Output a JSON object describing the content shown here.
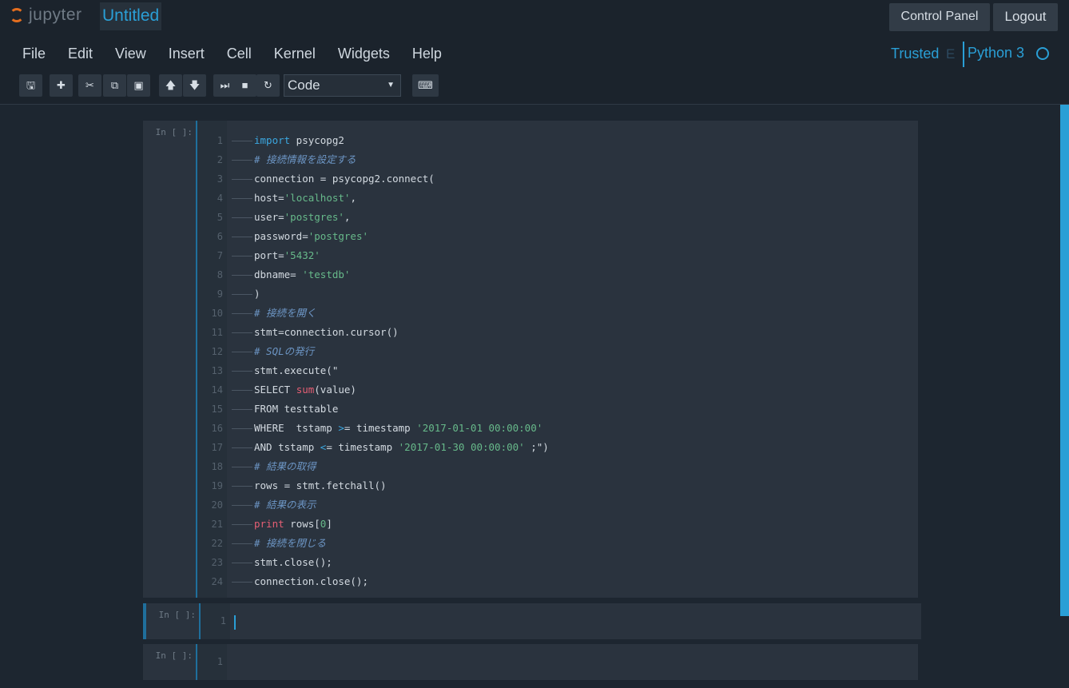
{
  "header": {
    "logo_text": "jupyter",
    "notebook_name": "Untitled",
    "control_panel_label": "Control Panel",
    "logout_label": "Logout"
  },
  "menu": [
    "File",
    "Edit",
    "View",
    "Insert",
    "Cell",
    "Kernel",
    "Widgets",
    "Help"
  ],
  "status": {
    "trusted": "Trusted",
    "mode_indicator": "E",
    "kernel": "Python 3"
  },
  "toolbar": {
    "buttons": [
      {
        "name": "save-button",
        "icon": "floppy-disk-icon",
        "glyph": "🖫"
      },
      {
        "name": "insert-cell-button",
        "icon": "plus-icon",
        "glyph": "✚"
      },
      {
        "name": "cut-button",
        "icon": "scissors-icon",
        "glyph": "✂"
      },
      {
        "name": "copy-button",
        "icon": "copy-icon",
        "glyph": "⧉"
      },
      {
        "name": "paste-button",
        "icon": "paste-icon",
        "glyph": "▣"
      },
      {
        "name": "move-up-button",
        "icon": "arrow-up-icon",
        "glyph": "🡅"
      },
      {
        "name": "move-down-button",
        "icon": "arrow-down-icon",
        "glyph": "🡇"
      },
      {
        "name": "run-button",
        "icon": "step-forward-icon",
        "glyph": "⏭"
      },
      {
        "name": "interrupt-button",
        "icon": "stop-icon",
        "glyph": "■"
      },
      {
        "name": "restart-button",
        "icon": "refresh-icon",
        "glyph": "↻"
      },
      {
        "name": "command-palette-button",
        "icon": "keyboard-icon",
        "glyph": "⌨"
      }
    ],
    "cell_type": "Code"
  },
  "cells": [
    {
      "prompt": "In [ ]:",
      "lines": [
        [
          {
            "t": "import",
            "c": "kw"
          },
          {
            "t": " psycopg2"
          }
        ],
        [
          {
            "t": "# 接続情報を設定する",
            "c": "cm"
          }
        ],
        [
          {
            "t": "connection = psycopg2.connect("
          }
        ],
        [
          {
            "t": "host="
          },
          {
            "t": "'localhost'",
            "c": "st"
          },
          {
            "t": ","
          }
        ],
        [
          {
            "t": "user="
          },
          {
            "t": "'postgres'",
            "c": "st"
          },
          {
            "t": ","
          }
        ],
        [
          {
            "t": "password="
          },
          {
            "t": "'postgres'",
            "c": "st"
          }
        ],
        [
          {
            "t": "port="
          },
          {
            "t": "'5432'",
            "c": "st"
          }
        ],
        [
          {
            "t": "dbname= "
          },
          {
            "t": "'testdb'",
            "c": "st"
          }
        ],
        [
          {
            "t": ")"
          }
        ],
        [
          {
            "t": "# 接続を開く",
            "c": "cm"
          }
        ],
        [
          {
            "t": "stmt=connection.cursor()"
          }
        ],
        [
          {
            "t": "# SQLの発行",
            "c": "cm"
          }
        ],
        [
          {
            "t": "stmt.execute(\""
          }
        ],
        [
          {
            "t": "SELECT "
          },
          {
            "t": "sum",
            "c": "fn"
          },
          {
            "t": "(value)"
          }
        ],
        [
          {
            "t": "FROM testtable"
          }
        ],
        [
          {
            "t": "WHERE  tstamp "
          },
          {
            "t": ">",
            "c": "kw"
          },
          {
            "t": "= timestamp "
          },
          {
            "t": "'2017-01-01 00:00:00'",
            "c": "st"
          }
        ],
        [
          {
            "t": "AND tstamp "
          },
          {
            "t": "<",
            "c": "kw"
          },
          {
            "t": "= timestamp "
          },
          {
            "t": "'2017-01-30 00:00:00'",
            "c": "st"
          },
          {
            "t": " ;\")"
          }
        ],
        [
          {
            "t": "# 結果の取得",
            "c": "cm"
          }
        ],
        [
          {
            "t": "rows = stmt.fetchall()"
          }
        ],
        [
          {
            "t": "# 結果の表示",
            "c": "cm"
          }
        ],
        [
          {
            "t": "print",
            "c": "fn"
          },
          {
            "t": " rows["
          },
          {
            "t": "0",
            "c": "st"
          },
          {
            "t": "]"
          }
        ],
        [
          {
            "t": "# 接続を閉じる",
            "c": "cm"
          }
        ],
        [
          {
            "t": "stmt.close();"
          }
        ],
        [
          {
            "t": "connection.close();"
          }
        ]
      ]
    },
    {
      "prompt": "In [ ]:",
      "lines": [
        []
      ],
      "selected": true
    },
    {
      "prompt": "In [ ]:",
      "lines": [
        []
      ]
    }
  ]
}
